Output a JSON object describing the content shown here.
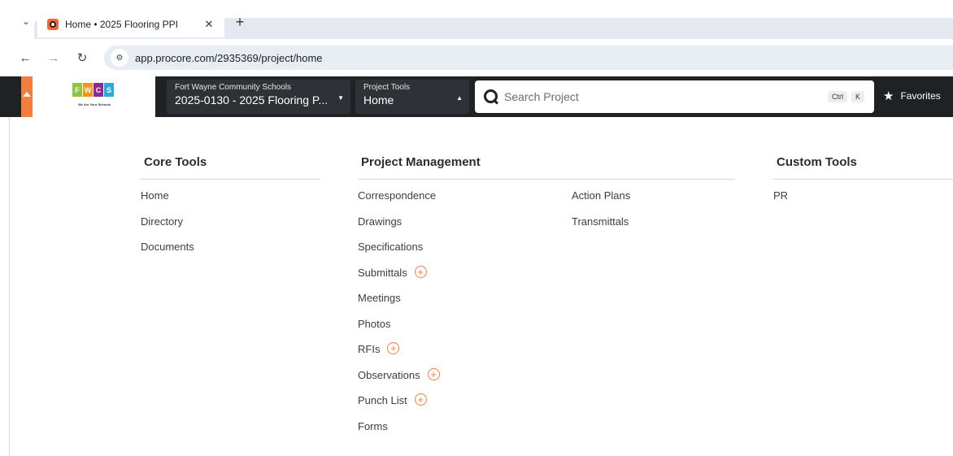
{
  "browser": {
    "tab_menu_icon": "chevron-down-icon",
    "tab_title": "Home • 2025 Flooring PPI",
    "tab_close": "✕",
    "new_tab": "+",
    "url": "app.procore.com/2935369/project/home"
  },
  "header": {
    "logo_letters": [
      "F",
      "W",
      "C",
      "S"
    ],
    "logo_colors": [
      "#8cc63f",
      "#f7941d",
      "#92278f",
      "#27aae1"
    ],
    "logo_tagline": "We Are Your Schools",
    "company_picker": {
      "label": "Fort Wayne Community Schools",
      "value": "2025-0130 - 2025 Flooring P..."
    },
    "tool_picker": {
      "label": "Project Tools",
      "value": "Home"
    },
    "search": {
      "placeholder": "Search Project",
      "shortcut_key1": "Ctrl",
      "shortcut_key2": "K"
    },
    "favorites_label": "Favorites"
  },
  "sections": {
    "core_tools": {
      "title": "Core Tools",
      "items": [
        "Home",
        "Directory",
        "Documents"
      ]
    },
    "project_management": {
      "title": "Project Management",
      "col1": [
        {
          "label": "Correspondence",
          "add": false
        },
        {
          "label": "Drawings",
          "add": false
        },
        {
          "label": "Specifications",
          "add": false
        },
        {
          "label": "Submittals",
          "add": true
        },
        {
          "label": "Meetings",
          "add": false
        },
        {
          "label": "Photos",
          "add": false
        },
        {
          "label": "RFIs",
          "add": true
        },
        {
          "label": "Observations",
          "add": true
        },
        {
          "label": "Punch List",
          "add": true
        },
        {
          "label": "Forms",
          "add": false
        }
      ],
      "col2": [
        {
          "label": "Action Plans",
          "add": false
        },
        {
          "label": "Transmittals",
          "add": false
        }
      ]
    },
    "custom_tools": {
      "title": "Custom Tools",
      "items": [
        "PR"
      ]
    }
  },
  "colors": {
    "accent": "#f47e3e",
    "header_bg": "#1f2124"
  }
}
